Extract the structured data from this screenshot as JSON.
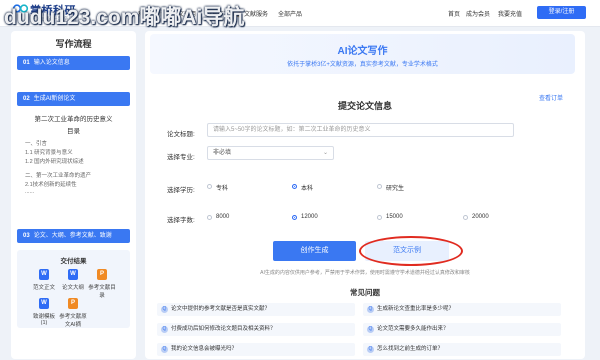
{
  "watermark": "dudu123.com嘟嘟Ai导航",
  "header": {
    "brand": "掌桥科研",
    "brand_sub": "一站式科研服务平台",
    "nav": [
      "科技查新",
      "论文引用",
      "AI写作工具",
      "文献服务",
      "全部产品"
    ],
    "hot_mark": "🔥",
    "right_links": [
      "首页",
      "成为会员",
      "我要充值"
    ],
    "login": "登录/注册"
  },
  "sidebar": {
    "title": "写作流程",
    "steps": [
      {
        "num": "01",
        "label": "输入论文信息"
      },
      {
        "num": "02",
        "label": "生成AI新创论文"
      },
      {
        "num": "03",
        "label": "论文、大纲、参考文献、致谢"
      }
    ],
    "outline": {
      "title": "第二次工业革命的历史意义",
      "subtitle": "目录",
      "lines": [
        "一、引言",
        "1.1 研究背景与意义",
        "1.2 国内外研究现状综述",
        "二、第一次工业革命的遗产",
        "2.1技术创新的延续性",
        "......"
      ]
    },
    "deliver": {
      "title": "交付结果",
      "items": [
        {
          "label": "范文正文",
          "color": "#2f6cf5"
        },
        {
          "label": "论文大纲",
          "color": "#2f6cf5"
        },
        {
          "label": "参考文献目录",
          "color": "#f08a24"
        },
        {
          "label": "致谢模板(1)",
          "color": "#2f6cf5"
        },
        {
          "label": "参考文献原文AI摘",
          "color": "#f08a24"
        }
      ]
    }
  },
  "main": {
    "banner_title": "AI论文写作",
    "banner_sub": "依托于掌桥3亿+文献资源，真实参考文献，专业学术格式",
    "sample_link": "查看订单",
    "form_title": "提交论文信息",
    "topic_label": "论文标题:",
    "topic_placeholder": "请输入5~50字的论文标题，如：第二次工业革命的历史意义",
    "major_label": "选择专业:",
    "major_value": "非必填",
    "degree_label": "选择学历:",
    "degrees": [
      "专科",
      "本科",
      "研究生"
    ],
    "degree_selected": 1,
    "words_label": "选择字数:",
    "word_counts": [
      "8000",
      "12000",
      "15000",
      "20000"
    ],
    "words_selected": 1,
    "generate_button": "创作生成",
    "sample_button": "范文示例",
    "disclaimer": "AI生成的内容仅供用户参考，严禁用于学术作弊，使用时需遵守学术道德并经过认真修改和审核",
    "faq_title": "常见问题",
    "faq": [
      "论文中提供的参考文献是否是真实文献？",
      "生成新论文查重比率是多少呢？",
      "付费成功后如何修改论文题目及相关资料？",
      "论文范文需要多久能作出来？",
      "我的论文信息会被曝光吗？",
      "怎么找到之前生成的订单？"
    ]
  },
  "colors": {
    "accent": "#3a78f2",
    "highlight_ring": "#e02b20"
  }
}
